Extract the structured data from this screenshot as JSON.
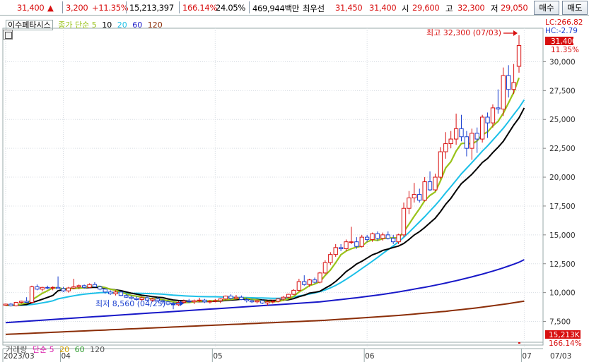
{
  "infobar": {
    "price": "31,400",
    "arrow": "▲",
    "change": "3,200",
    "change_pct": "+11.35%",
    "volume": "15,213,397",
    "vol_ratio": "166.14%",
    "turnover": "24.05%",
    "amount": "469,944백만",
    "best_ask_label": "최우선",
    "best_ask": "31,450",
    "best_bid": "31,400",
    "open_label": "시",
    "open": "29,600",
    "high_label": "고",
    "high": "32,300",
    "low_label": "저",
    "low": "29,050",
    "buy_label": "매수",
    "sell_label": "매도"
  },
  "legend": {
    "name": "이수페타시스",
    "ma_title": "종가 단순 5",
    "ma10": "10",
    "ma20": "20",
    "ma60": "60",
    "ma120": "120"
  },
  "volume_legend": {
    "title": "거래량",
    "ma_title": "단순 5",
    "ma20": "20",
    "ma60": "60",
    "ma120": "120"
  },
  "annotations": {
    "high": "최고 32,300 (07/03)",
    "low": "최저 8,560 (04/25)"
  },
  "axis_labels": {
    "lc": "LC:266.82",
    "hc": "HC:-2.79",
    "last": "31,400",
    "pct": "11.35%",
    "vol_last": "15,213K",
    "vol_pct": "166.14%",
    "date_right": "07/03"
  },
  "colors": {
    "up": "#d81010",
    "down": "#1a3fcf",
    "ma5": "#9ac31a",
    "ma10": "#000000",
    "ma20": "#1cc0e8",
    "ma60": "#1818c8",
    "ma120": "#8b2e08"
  },
  "chart_data": {
    "type": "candlestick",
    "title": "이수페타시스",
    "y_ticks": [
      "30,000",
      "27,500",
      "25,000",
      "22,500",
      "20,000",
      "17,500",
      "15,000",
      "12,500",
      "10,000",
      "7,500"
    ],
    "y_tick_values": [
      30000,
      27500,
      25000,
      22500,
      20000,
      17500,
      15000,
      12500,
      10000,
      7500
    ],
    "ylim": [
      5700,
      32900
    ],
    "x_labels": [
      {
        "label": "2023/03",
        "index": 0
      },
      {
        "label": "04",
        "index": 11
      },
      {
        "label": "05",
        "index": 40
      },
      {
        "label": "06",
        "index": 69
      },
      {
        "label": "07",
        "index": 99
      }
    ],
    "candles": [
      [
        8900,
        9050,
        8850,
        9000
      ],
      [
        9000,
        9100,
        8800,
        8850
      ],
      [
        8850,
        9200,
        8800,
        9150
      ],
      [
        9150,
        9300,
        9050,
        9250
      ],
      [
        9250,
        9600,
        9100,
        9150
      ],
      [
        9150,
        10600,
        9100,
        10500
      ],
      [
        10500,
        10700,
        10200,
        10300
      ],
      [
        10300,
        10500,
        10100,
        10450
      ],
      [
        10450,
        10600,
        10300,
        10400
      ],
      [
        10400,
        10550,
        10200,
        10450
      ],
      [
        10450,
        11400,
        10350,
        10350
      ],
      [
        10350,
        10500,
        10050,
        10150
      ],
      [
        10150,
        10500,
        10000,
        10400
      ],
      [
        10400,
        11200,
        10300,
        10500
      ],
      [
        10500,
        10700,
        10300,
        10600
      ],
      [
        10600,
        10700,
        10350,
        10450
      ],
      [
        10450,
        10800,
        10400,
        10700
      ],
      [
        10700,
        10900,
        10500,
        10500
      ],
      [
        10500,
        10600,
        10200,
        10300
      ],
      [
        10300,
        10400,
        9900,
        10050
      ],
      [
        10050,
        10200,
        9800,
        9900
      ],
      [
        9900,
        10200,
        9750,
        10050
      ],
      [
        10050,
        10150,
        9700,
        9750
      ],
      [
        9750,
        9900,
        9550,
        9600
      ],
      [
        9600,
        9750,
        9400,
        9500
      ],
      [
        9500,
        9700,
        9300,
        9400
      ],
      [
        9400,
        9650,
        9300,
        9550
      ],
      [
        9550,
        9700,
        9300,
        9350
      ],
      [
        9350,
        9550,
        9200,
        9450
      ],
      [
        9450,
        9600,
        9200,
        9300
      ],
      [
        9300,
        9400,
        9000,
        9200
      ],
      [
        9200,
        9300,
        8900,
        9000
      ],
      [
        9000,
        9200,
        8560,
        8950
      ],
      [
        8950,
        9250,
        8850,
        9150
      ],
      [
        9150,
        9400,
        9050,
        9250
      ],
      [
        9250,
        9450,
        9100,
        9200
      ],
      [
        9200,
        9400,
        9000,
        9300
      ],
      [
        9300,
        9550,
        9150,
        9350
      ],
      [
        9350,
        9450,
        9100,
        9200
      ],
      [
        9200,
        9350,
        9050,
        9250
      ],
      [
        9250,
        9450,
        9150,
        9300
      ],
      [
        9300,
        9500,
        9100,
        9450
      ],
      [
        9450,
        9750,
        9350,
        9700
      ],
      [
        9700,
        9850,
        9400,
        9500
      ],
      [
        9500,
        9800,
        9450,
        9600
      ],
      [
        9600,
        9750,
        9350,
        9400
      ],
      [
        9400,
        9550,
        9150,
        9300
      ],
      [
        9300,
        9450,
        9100,
        9200
      ],
      [
        9200,
        9400,
        9050,
        9300
      ],
      [
        9300,
        9400,
        9000,
        9100
      ],
      [
        9100,
        9300,
        8900,
        9200
      ],
      [
        9200,
        9350,
        9050,
        9250
      ],
      [
        9250,
        9500,
        9150,
        9450
      ],
      [
        9450,
        9700,
        9300,
        9600
      ],
      [
        9600,
        9900,
        9500,
        9850
      ],
      [
        9850,
        10300,
        9800,
        10200
      ],
      [
        10200,
        11200,
        10100,
        10950
      ],
      [
        10950,
        11500,
        10600,
        10700
      ],
      [
        10700,
        11200,
        10500,
        11100
      ],
      [
        11100,
        11300,
        10800,
        10900
      ],
      [
        10900,
        11800,
        10800,
        11700
      ],
      [
        11700,
        12800,
        11600,
        12600
      ],
      [
        12600,
        13500,
        12400,
        13300
      ],
      [
        13300,
        14200,
        13100,
        13900
      ],
      [
        13900,
        14200,
        13600,
        13800
      ],
      [
        13800,
        14600,
        13600,
        14400
      ],
      [
        14400,
        15700,
        14200,
        14400
      ],
      [
        14400,
        14800,
        13800,
        14000
      ],
      [
        14000,
        15000,
        13900,
        14800
      ],
      [
        14800,
        15000,
        14400,
        14600
      ],
      [
        14600,
        15200,
        14400,
        15100
      ],
      [
        15100,
        15300,
        14500,
        14700
      ],
      [
        14700,
        15200,
        14500,
        15000
      ],
      [
        15000,
        15300,
        14600,
        14700
      ],
      [
        14700,
        15000,
        14200,
        14400
      ],
      [
        14400,
        15100,
        14200,
        15000
      ],
      [
        15000,
        17800,
        14800,
        17300
      ],
      [
        17300,
        18800,
        16800,
        18200
      ],
      [
        18200,
        19500,
        17800,
        18500
      ],
      [
        18500,
        19000,
        17800,
        18000
      ],
      [
        18000,
        20000,
        17900,
        19600
      ],
      [
        19600,
        20500,
        18800,
        18900
      ],
      [
        18900,
        20300,
        18800,
        20000
      ],
      [
        20000,
        22600,
        19800,
        22200
      ],
      [
        22200,
        23900,
        21600,
        22900
      ],
      [
        22900,
        24000,
        22500,
        23300
      ],
      [
        23300,
        25500,
        22800,
        24200
      ],
      [
        24200,
        25400,
        23100,
        23500
      ],
      [
        23500,
        24000,
        21800,
        22500
      ],
      [
        22500,
        24200,
        21500,
        23800
      ],
      [
        23800,
        24300,
        22100,
        23300
      ],
      [
        23300,
        25400,
        23000,
        25200
      ],
      [
        25200,
        25600,
        23400,
        24700
      ],
      [
        24700,
        26300,
        24300,
        26000
      ],
      [
        26000,
        27600,
        25500,
        25900
      ],
      [
        25900,
        29500,
        25300,
        28800
      ],
      [
        28800,
        29700,
        26900,
        27600
      ],
      [
        27600,
        29800,
        27200,
        28200
      ],
      [
        29600,
        32300,
        29050,
        31400
      ]
    ],
    "series": [
      {
        "name": "5",
        "values": [
          8900,
          8880,
          8910,
          9010,
          9090,
          9360,
          9650,
          9940,
          10160,
          10410,
          10410,
          10330,
          10360,
          10360,
          10390,
          10420,
          10530,
          10540,
          10530,
          10430,
          10290,
          10200,
          10040,
          9890,
          9750,
          9690,
          9600,
          9520,
          9480,
          9450,
          9380,
          9300,
          9190,
          9120,
          9120,
          9140,
          9200,
          9260,
          9270,
          9280,
          9280,
          9310,
          9390,
          9420,
          9470,
          9540,
          9510,
          9420,
          9360,
          9280,
          9220,
          9210,
          9240,
          9330,
          9470,
          9680,
          10050,
          10300,
          10610,
          10740,
          10950,
          11490,
          11950,
          12590,
          13280,
          13600,
          13800,
          13940,
          14020,
          14400,
          14580,
          14520,
          14680,
          14720,
          14740,
          14750,
          15260,
          15920,
          16610,
          17250,
          17970,
          18420,
          18720,
          19670,
          20800,
          21340,
          22260,
          22910,
          22960,
          22860,
          23140,
          23670,
          23920,
          24440,
          24830,
          25540,
          26440,
          27350,
          28600
        ]
      },
      {
        "name": "10",
        "values": [
          8900,
          8890,
          8900,
          8940,
          8970,
          9130,
          9270,
          9420,
          9590,
          9750,
          10160,
          10260,
          10350,
          10370,
          10400,
          10410,
          10440,
          10460,
          10440,
          10400,
          10300,
          10230,
          10170,
          10060,
          9950,
          9860,
          9770,
          9720,
          9650,
          9600,
          9560,
          9450,
          9360,
          9310,
          9290,
          9250,
          9220,
          9220,
          9230,
          9230,
          9250,
          9270,
          9320,
          9360,
          9380,
          9430,
          9430,
          9420,
          9400,
          9360,
          9330,
          9320,
          9330,
          9350,
          9380,
          9480,
          9650,
          9770,
          9960,
          10020,
          10120,
          10380,
          10630,
          10960,
          11370,
          11820,
          12130,
          12480,
          12720,
          12990,
          13270,
          13440,
          13660,
          13770,
          13910,
          14030,
          14260,
          14600,
          14990,
          15280,
          15640,
          16050,
          16440,
          17010,
          17650,
          18170,
          18830,
          19440,
          19840,
          20240,
          20740,
          21270,
          21620,
          22130,
          22590,
          23100,
          23810,
          24520,
          25130,
          26000
        ]
      },
      {
        "name": "20",
        "values": [
          8900,
          8900,
          8900,
          8910,
          8920,
          8970,
          9030,
          9110,
          9190,
          9290,
          9460,
          9550,
          9640,
          9720,
          9800,
          9860,
          9910,
          9950,
          9990,
          10010,
          10010,
          10000,
          10000,
          9970,
          9950,
          9940,
          9930,
          9920,
          9910,
          9890,
          9860,
          9820,
          9780,
          9750,
          9720,
          9700,
          9680,
          9660,
          9650,
          9640,
          9640,
          9630,
          9610,
          9590,
          9580,
          9570,
          9560,
          9550,
          9540,
          9530,
          9520,
          9510,
          9510,
          9520,
          9550,
          9620,
          9710,
          9790,
          9880,
          9970,
          10080,
          10230,
          10410,
          10620,
          10870,
          11150,
          11450,
          11760,
          12080,
          12400,
          12720,
          13050,
          13390,
          13720,
          14050,
          14400,
          14790,
          15220,
          15670,
          16120,
          16580,
          17070,
          17550,
          18080,
          18640,
          19180,
          19730,
          20290,
          20770,
          21250,
          21750,
          22250,
          22710,
          23220,
          23720,
          24240,
          24820,
          25430,
          26010,
          26700
        ]
      },
      {
        "name": "60",
        "values": [
          7400,
          7430,
          7460,
          7490,
          7520,
          7550,
          7580,
          7610,
          7640,
          7670,
          7700,
          7730,
          7760,
          7790,
          7820,
          7850,
          7880,
          7910,
          7940,
          7970,
          8000,
          8030,
          8060,
          8090,
          8120,
          8150,
          8180,
          8210,
          8240,
          8270,
          8300,
          8330,
          8360,
          8390,
          8420,
          8450,
          8480,
          8510,
          8540,
          8570,
          8600,
          8630,
          8660,
          8690,
          8720,
          8750,
          8780,
          8810,
          8840,
          8870,
          8900,
          8930,
          8960,
          8990,
          9020,
          9050,
          9080,
          9110,
          9140,
          9170,
          9200,
          9250,
          9300,
          9350,
          9400,
          9450,
          9500,
          9550,
          9610,
          9670,
          9730,
          9790,
          9850,
          9920,
          9990,
          10060,
          10140,
          10220,
          10300,
          10380,
          10460,
          10550,
          10640,
          10730,
          10830,
          10930,
          11030,
          11140,
          11250,
          11360,
          11480,
          11600,
          11730,
          11860,
          12000,
          12140,
          12300,
          12460,
          12630,
          12850
        ]
      },
      {
        "name": "120",
        "values": [
          6380,
          6400,
          6420,
          6440,
          6460,
          6480,
          6500,
          6520,
          6540,
          6560,
          6580,
          6600,
          6620,
          6640,
          6660,
          6680,
          6700,
          6720,
          6740,
          6760,
          6780,
          6800,
          6820,
          6840,
          6860,
          6880,
          6900,
          6920,
          6940,
          6960,
          6980,
          7000,
          7020,
          7040,
          7060,
          7080,
          7100,
          7120,
          7140,
          7160,
          7180,
          7200,
          7220,
          7240,
          7260,
          7280,
          7300,
          7320,
          7340,
          7360,
          7380,
          7400,
          7420,
          7440,
          7460,
          7480,
          7500,
          7520,
          7540,
          7560,
          7580,
          7600,
          7630,
          7660,
          7690,
          7720,
          7750,
          7780,
          7810,
          7840,
          7870,
          7900,
          7930,
          7960,
          7990,
          8020,
          8060,
          8100,
          8140,
          8180,
          8220,
          8260,
          8300,
          8340,
          8380,
          8430,
          8480,
          8530,
          8580,
          8630,
          8680,
          8740,
          8800,
          8860,
          8920,
          8980,
          9050,
          9120,
          9190,
          9260
        ]
      }
    ]
  }
}
